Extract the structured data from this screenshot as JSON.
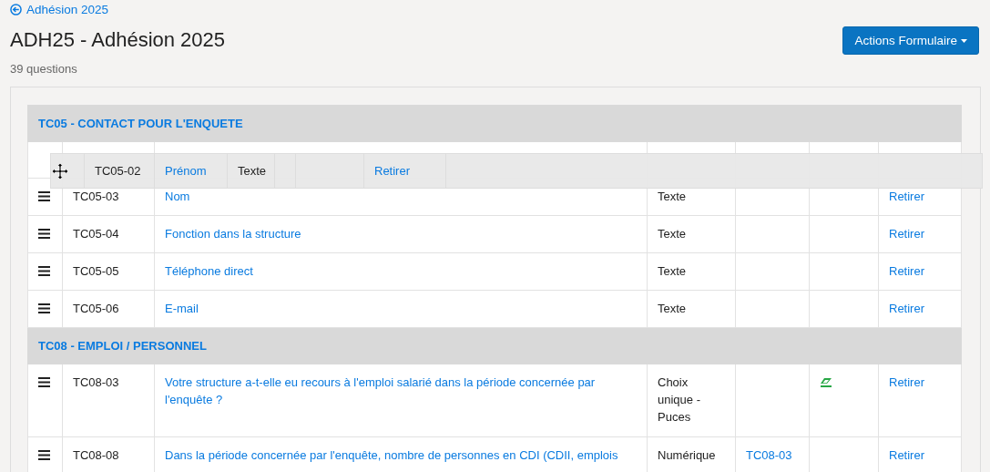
{
  "back_link": "Adhésion 2025",
  "title": "ADH25 - Adhésion 2025",
  "subtitle": "39 questions",
  "actions_button": "Actions Formulaire",
  "groups": [
    {
      "title": "TC05 - CONTACT POUR L'ENQUETE",
      "rows": [
        {
          "code": "TC05-02",
          "label": "Prénom",
          "type": "Texte",
          "depends_on": "",
          "rule_icon": false,
          "action": "Retirer",
          "dragging": true
        },
        {
          "code": "TC05-03",
          "label": "Nom",
          "type": "Texte",
          "depends_on": "",
          "rule_icon": false,
          "action": "Retirer",
          "dragging": false
        },
        {
          "code": "TC05-04",
          "label": "Fonction dans la structure",
          "type": "Texte",
          "depends_on": "",
          "rule_icon": false,
          "action": "Retirer",
          "dragging": false
        },
        {
          "code": "TC05-05",
          "label": "Téléphone direct",
          "type": "Texte",
          "depends_on": "",
          "rule_icon": false,
          "action": "Retirer",
          "dragging": false
        },
        {
          "code": "TC05-06",
          "label": "E-mail",
          "type": "Texte",
          "depends_on": "",
          "rule_icon": false,
          "action": "Retirer",
          "dragging": false
        }
      ]
    },
    {
      "title": "TC08 - EMPLOI / PERSONNEL",
      "rows": [
        {
          "code": "TC08-03",
          "label": "Votre structure a-t-elle eu recours à l'emploi salarié dans la période concernée par l'enquête ?",
          "type": "Choix unique - Puces",
          "depends_on": "",
          "rule_icon": true,
          "action": "Retirer",
          "dragging": false
        },
        {
          "code": "TC08-08",
          "label": "Dans la période concernée par l'enquête, nombre de personnes en CDI (CDII, emplois",
          "type": "Numérique",
          "depends_on": "TC08-03",
          "rule_icon": false,
          "action": "Retirer",
          "dragging": false
        }
      ]
    }
  ]
}
